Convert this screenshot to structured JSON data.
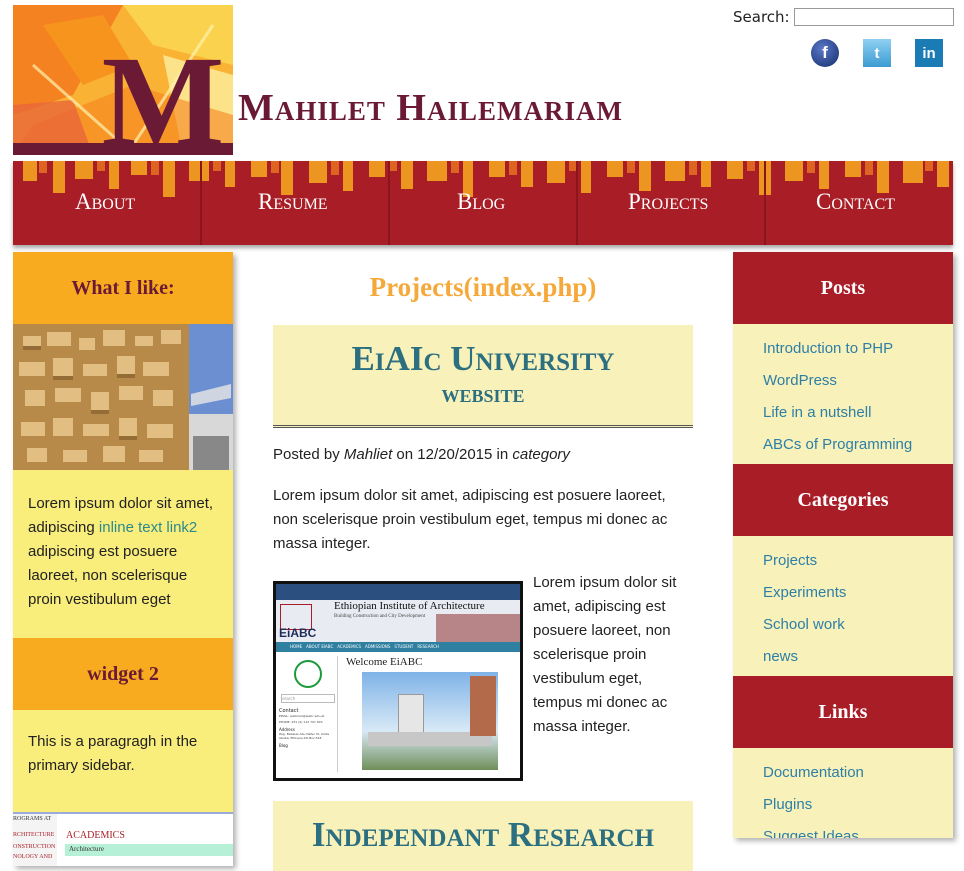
{
  "header": {
    "site_title": "Mahilet Hailemariam",
    "logo_letter": "M",
    "search_label": "Search:",
    "search_placeholder": "",
    "social": [
      {
        "name": "facebook-icon",
        "glyph": "f"
      },
      {
        "name": "twitter-icon",
        "glyph": "t"
      },
      {
        "name": "linkedin-icon",
        "glyph": "in"
      }
    ]
  },
  "nav": {
    "items": [
      "About",
      "Resume",
      "Blog",
      "Projects",
      "Contact"
    ]
  },
  "left_sidebar": {
    "widget1_title": "What I like:",
    "widget1_text_before": "Lorem ipsum dolor sit amet, adipiscing ",
    "widget1_link": "inline text link2",
    "widget1_text_after": " adipiscing est posuere laoreet, non scelerisque proin vestibulum eget",
    "widget2_title": "widget 2",
    "widget2_text": "This is a paragragh in the primary sidebar.",
    "thumb_texts": [
      "ROGRAMS AT",
      "ACADEMICS",
      "RCHITECTURE",
      "ONSTRUCTION",
      "NOLOGY AND",
      "Architecture"
    ]
  },
  "main": {
    "page_title": "Projects(index.php)",
    "post1": {
      "title_line1": "EiAIc University",
      "title_line2": "website",
      "posted_by": "Posted by ",
      "author": "Mahliet",
      "on": " on ",
      "date": "12/20/2015",
      "in": " in ",
      "category": "category",
      "para1": "Lorem ipsum dolor sit amet, adipiscing est posuere laoreet, non scelerisque proin vestibulum eget, tempus mi donec ac massa integer.",
      "para2": "Lorem ipsum dolor sit amet, adipiscing est posuere laoreet, non scelerisque proin vestibulum eget, tempus mi donec ac massa integer.",
      "thumb": {
        "header": "Ethiopian Institute of Architecture",
        "subheader": "Building Construction and City Development",
        "brand": "EiABC",
        "nav": [
          "HOME",
          "ABOUT EIABC",
          "ACADEMICS",
          "ADMISSIONS",
          "STUDENT",
          "RESEARCH"
        ],
        "welcome": "Welcome EiABC",
        "search": "search",
        "contact": "Contact",
        "email": "EMAIL: webmail@eiabc.edu.et",
        "phone": "PHONE: 251 (0) 112 707 003",
        "address_label": "Address",
        "address": "Zeg. Babelas Abu Nefso St, Addis Ababa, Ethiopia P.O.Box:518",
        "blog": "Blog"
      }
    },
    "post2": {
      "title": "Independant Research"
    }
  },
  "right_sidebar": {
    "sections": [
      {
        "title": "Posts",
        "items": [
          "Introduction to PHP",
          "WordPress",
          "Life in a nutshell",
          "ABCs of Programming"
        ]
      },
      {
        "title": "Categories",
        "items": [
          "Projects",
          "Experiments",
          "School work",
          "news"
        ]
      },
      {
        "title": "Links",
        "items": [
          "Documentation",
          "Plugins",
          "Suggest Ideas"
        ]
      }
    ]
  },
  "colors": {
    "brand_maroon": "#6b1a35",
    "nav_red": "#a81d26",
    "accent_orange": "#f9ab1f",
    "sidebar_yellow": "#f9ed7b",
    "panel_cream": "#f8f1b9",
    "heading_teal": "#2b6f80",
    "link_blue": "#2d7fa8"
  }
}
